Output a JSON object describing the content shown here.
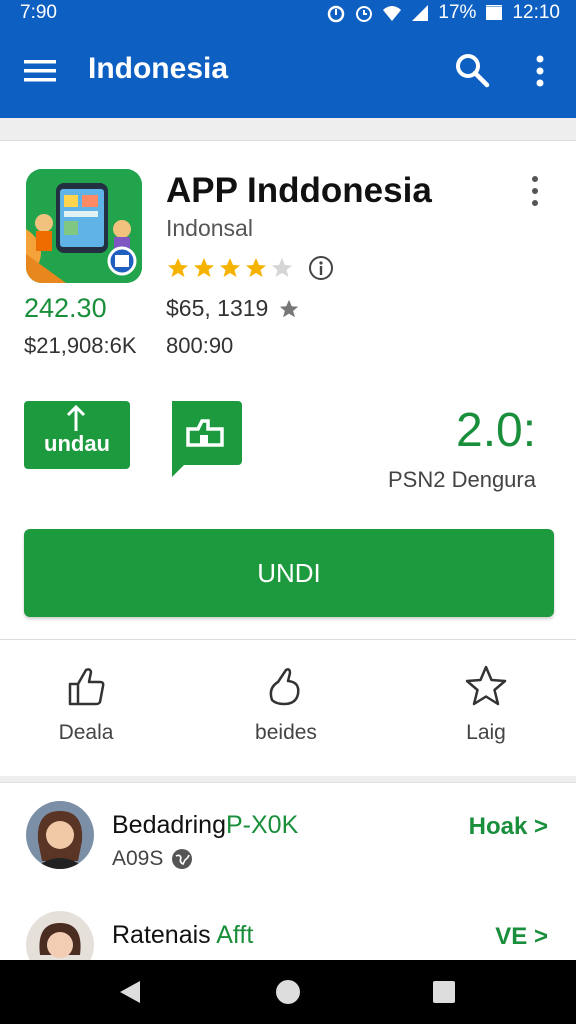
{
  "status_bar": {
    "time_left": "7:90",
    "battery": "17%",
    "time": "12:10"
  },
  "app_bar": {
    "title": "Indonesia"
  },
  "app": {
    "name": "APP Inddonesia",
    "developer": "Indonsal",
    "rating_stars": 4,
    "rating_max": 5,
    "price_green": "242.30",
    "price_mid": "$65, 1319",
    "sub_left": "$21,908:6K",
    "sub_mid": "800:90",
    "undau_label": "undau",
    "rating_number": "2.0:",
    "rating_sub": "PSN2 Dengura",
    "install_label": "UNDI"
  },
  "actions": [
    {
      "label": "Deala",
      "icon": "thumbs-up-outline-icon"
    },
    {
      "label": "beides",
      "icon": "thumbs-up-outline-icon"
    },
    {
      "label": "Laig",
      "icon": "star-outline-icon"
    }
  ],
  "list": [
    {
      "title_plain": "Bedadring",
      "title_accent": "P-X0K",
      "sub": "A09S",
      "action": "Hoak >"
    },
    {
      "title_plain": "Ratenais",
      "title_accent": "Afft",
      "sub": "",
      "action": "VE >"
    }
  ],
  "colors": {
    "app_bar": "#0d60c2",
    "green": "#1e9a3e",
    "accent_text": "#1a8f3b",
    "star": "#f5b300"
  }
}
